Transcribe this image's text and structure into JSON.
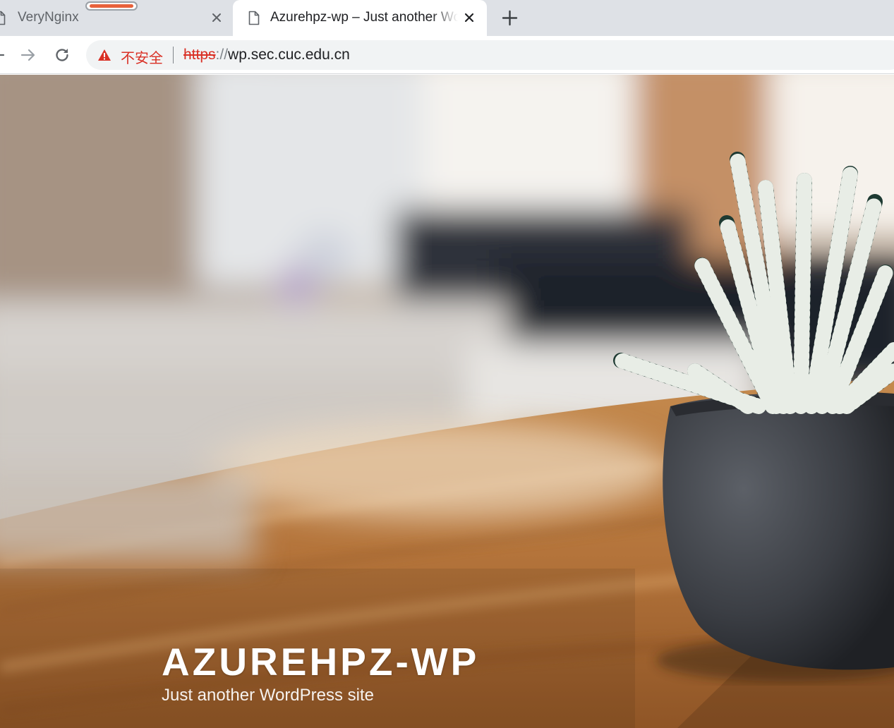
{
  "browser": {
    "tabs": [
      {
        "title": "VeryNginx",
        "active": false
      },
      {
        "title": "Azurehpz-wp – Just another WordPress site",
        "active": true
      }
    ],
    "address_bar": {
      "security_label": "不安全",
      "url_scheme": "https",
      "url_slashes": "://",
      "url_host": "wp.sec.cuc.edu.cn"
    },
    "icons": [
      "page-icon",
      "close-icon",
      "new-tab-icon",
      "back-arrow-icon",
      "forward-arrow-icon",
      "reload-icon",
      "warning-triangle-icon"
    ],
    "colors": {
      "insecure_red": "#d93025",
      "tabstrip": "#dee1e6",
      "omnibox": "#f1f3f4",
      "audio_indicator": "#e8613b"
    }
  },
  "site": {
    "title": "AZUREHPZ-WP",
    "description": "Just another WordPress site"
  }
}
